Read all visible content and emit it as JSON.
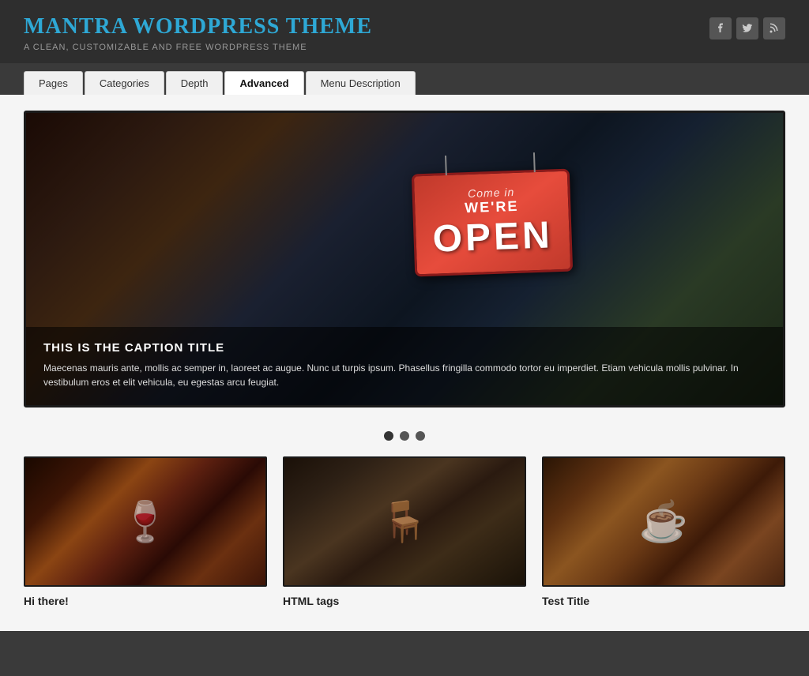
{
  "header": {
    "site_title": "Mantra WordPress Theme",
    "site_subtitle": "A Clean, Customizable and Free WordPress Theme",
    "social": {
      "facebook_icon": "f",
      "twitter_icon": "t",
      "rss_icon": "r"
    }
  },
  "nav": {
    "tabs": [
      {
        "id": "pages",
        "label": "Pages",
        "active": false
      },
      {
        "id": "categories",
        "label": "Categories",
        "active": false
      },
      {
        "id": "depth",
        "label": "Depth",
        "active": false
      },
      {
        "id": "advanced",
        "label": "Advanced",
        "active": true
      },
      {
        "id": "menu-description",
        "label": "Menu Description",
        "active": false
      }
    ]
  },
  "slider": {
    "caption_title": "This Is The Caption Title",
    "caption_text": "Maecenas mauris ante, mollis ac semper in, laoreet ac augue. Nunc ut turpis ipsum. Phasellus fringilla commodo tortor eu imperdiet. Etiam vehicula mollis pulvinar. In vestibulum eros et elit vehicula, eu egestas arcu feugiat.",
    "sign_come_in": "Come in",
    "sign_were": "WE'RE",
    "sign_open": "OPEN",
    "dots": [
      {
        "active": true
      },
      {
        "active": false
      },
      {
        "active": false
      }
    ]
  },
  "cards": [
    {
      "title": "Hi there!",
      "image_alt": "Wine glasses photo"
    },
    {
      "title": "HTML tags",
      "image_alt": "Restaurant interior photo"
    },
    {
      "title": "Test Title",
      "image_alt": "Coffee machine photo"
    }
  ]
}
